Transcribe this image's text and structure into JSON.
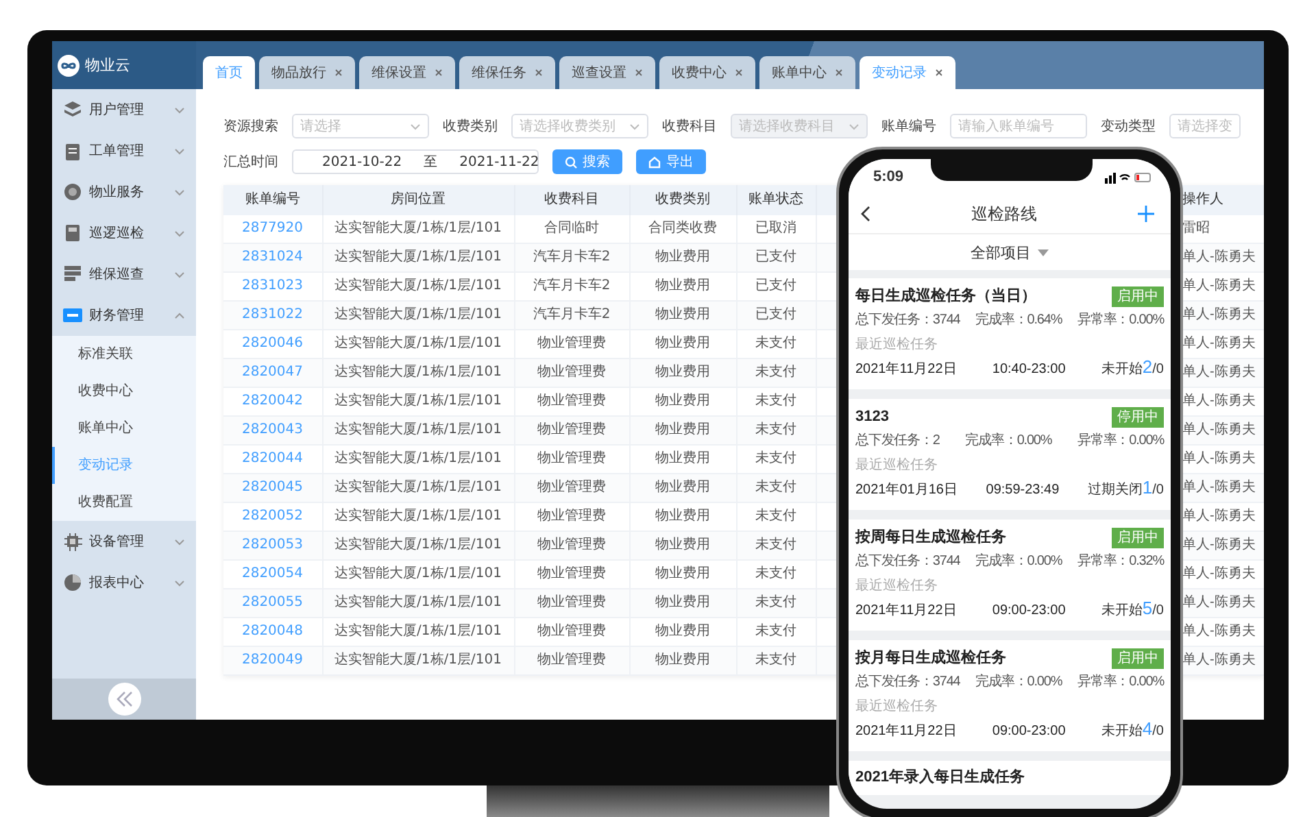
{
  "app": {
    "logo_text": "物业云"
  },
  "tabs": [
    {
      "label": "首页",
      "selected": true,
      "closable": false
    },
    {
      "label": "物品放行",
      "selected": false,
      "closable": true
    },
    {
      "label": "维保设置",
      "selected": false,
      "closable": true
    },
    {
      "label": "维保任务",
      "selected": false,
      "closable": true
    },
    {
      "label": "巡查设置",
      "selected": false,
      "closable": true
    },
    {
      "label": "收费中心",
      "selected": false,
      "closable": true
    },
    {
      "label": "账单中心",
      "selected": false,
      "closable": true
    },
    {
      "label": "变动记录",
      "selected": true,
      "closable": true
    }
  ],
  "sidebar": {
    "items": [
      {
        "label": "用户管理",
        "expanded": false
      },
      {
        "label": "工单管理",
        "expanded": false
      },
      {
        "label": "物业服务",
        "expanded": false
      },
      {
        "label": "巡逻巡检",
        "expanded": false
      },
      {
        "label": "维保巡查",
        "expanded": false
      },
      {
        "label": "财务管理",
        "expanded": true,
        "children": [
          {
            "label": "标准关联",
            "selected": false
          },
          {
            "label": "收费中心",
            "selected": false
          },
          {
            "label": "账单中心",
            "selected": false
          },
          {
            "label": "变动记录",
            "selected": true
          },
          {
            "label": "收费配置",
            "selected": false
          }
        ]
      },
      {
        "label": "设备管理",
        "expanded": false
      },
      {
        "label": "报表中心",
        "expanded": false
      }
    ]
  },
  "filters": [
    {
      "label": "资源搜索",
      "kind": "select",
      "placeholder": "请选择",
      "disabled": false
    },
    {
      "label": "收费类别",
      "kind": "select",
      "placeholder": "请选择收费类别",
      "disabled": false
    },
    {
      "label": "收费科目",
      "kind": "select",
      "placeholder": "请选择收费科目",
      "disabled": true
    },
    {
      "label": "账单编号",
      "kind": "input",
      "placeholder": "请输入账单编号",
      "disabled": false
    },
    {
      "label": "变动类型",
      "kind": "select_cut",
      "placeholder": "请选择变",
      "disabled": false
    }
  ],
  "date_filter": {
    "label": "汇总时间",
    "start": "2021-10-22",
    "separator": "至",
    "end": "2021-11-22"
  },
  "buttons": [
    {
      "label": "搜索"
    },
    {
      "label": "导出"
    }
  ],
  "table": {
    "columns": [
      "账单编号",
      "房间位置",
      "收费科目",
      "收费类别",
      "账单状态",
      "",
      "操作人"
    ],
    "rows": [
      [
        "2877920",
        "达实智能大厦/1栋/1层/101",
        "合同临时",
        "合同类收费",
        "已取消",
        "雷昭"
      ],
      [
        "2831024",
        "达实智能大厦/1栋/1层/101",
        "汽车月卡车2",
        "物业费用",
        "已支付",
        "单人-陈勇夫"
      ],
      [
        "2831023",
        "达实智能大厦/1栋/1层/101",
        "汽车月卡车2",
        "物业费用",
        "已支付",
        "单人-陈勇夫"
      ],
      [
        "2831022",
        "达实智能大厦/1栋/1层/101",
        "汽车月卡车2",
        "物业费用",
        "已支付",
        "单人-陈勇夫"
      ],
      [
        "2820046",
        "达实智能大厦/1栋/1层/101",
        "物业管理费",
        "物业费用",
        "未支付",
        "单人-陈勇夫"
      ],
      [
        "2820047",
        "达实智能大厦/1栋/1层/101",
        "物业管理费",
        "物业费用",
        "未支付",
        "单人-陈勇夫"
      ],
      [
        "2820042",
        "达实智能大厦/1栋/1层/101",
        "物业管理费",
        "物业费用",
        "未支付",
        "单人-陈勇夫"
      ],
      [
        "2820043",
        "达实智能大厦/1栋/1层/101",
        "物业管理费",
        "物业费用",
        "未支付",
        "单人-陈勇夫"
      ],
      [
        "2820044",
        "达实智能大厦/1栋/1层/101",
        "物业管理费",
        "物业费用",
        "未支付",
        "单人-陈勇夫"
      ],
      [
        "2820045",
        "达实智能大厦/1栋/1层/101",
        "物业管理费",
        "物业费用",
        "未支付",
        "单人-陈勇夫"
      ],
      [
        "2820052",
        "达实智能大厦/1栋/1层/101",
        "物业管理费",
        "物业费用",
        "未支付",
        "单人-陈勇夫"
      ],
      [
        "2820053",
        "达实智能大厦/1栋/1层/101",
        "物业管理费",
        "物业费用",
        "未支付",
        "单人-陈勇夫"
      ],
      [
        "2820054",
        "达实智能大厦/1栋/1层/101",
        "物业管理费",
        "物业费用",
        "未支付",
        "单人-陈勇夫"
      ],
      [
        "2820055",
        "达实智能大厦/1栋/1层/101",
        "物业管理费",
        "物业费用",
        "未支付",
        "单人-陈勇夫"
      ],
      [
        "2820048",
        "达实智能大厦/1栋/1层/101",
        "物业管理费",
        "物业费用",
        "未支付",
        "单人-陈勇夫"
      ],
      [
        "2820049",
        "达实智能大厦/1栋/1层/101",
        "物业管理费",
        "物业费用",
        "未支付",
        "单人-陈勇夫"
      ]
    ]
  },
  "phone": {
    "status_bar": {
      "time": "5:09"
    },
    "title": "巡检路线",
    "project_filter": "全部项目",
    "cards": [
      {
        "title": "每日生成巡检任务（当日）",
        "badge": "启用中",
        "stats": [
          "总下发任务：3744",
          "完成率：0.64%",
          "异常率：0.00%"
        ],
        "recent_label": "最近巡检任务",
        "date": "2021年11月22日",
        "time": "10:40-23:00",
        "status": "未开始",
        "count": "2",
        "total": "/0"
      },
      {
        "title": "3123",
        "badge": "停用中",
        "stats": [
          "总下发任务：2",
          "完成率：0.00%",
          "异常率：0.00%"
        ],
        "recent_label": "最近巡检任务",
        "date": "2021年01月16日",
        "time": "09:59-23:49",
        "status": "过期关闭",
        "count": "1",
        "total": "/0"
      },
      {
        "title": "按周每日生成巡检任务",
        "badge": "启用中",
        "stats": [
          "总下发任务：3744",
          "完成率：0.00%",
          "异常率：0.32%"
        ],
        "recent_label": "最近巡检任务",
        "date": "2021年11月22日",
        "time": "09:00-23:00",
        "status": "未开始",
        "count": "5",
        "total": "/0"
      },
      {
        "title": "按月每日生成巡检任务",
        "badge": "启用中",
        "stats": [
          "总下发任务：3744",
          "完成率：0.00%",
          "异常率：0.00%"
        ],
        "recent_label": "最近巡检任务",
        "date": "2021年11月22日",
        "time": "09:00-23:00",
        "status": "未开始",
        "count": "4",
        "total": "/0"
      },
      {
        "title": "2021年录入每日生成任务"
      }
    ]
  }
}
